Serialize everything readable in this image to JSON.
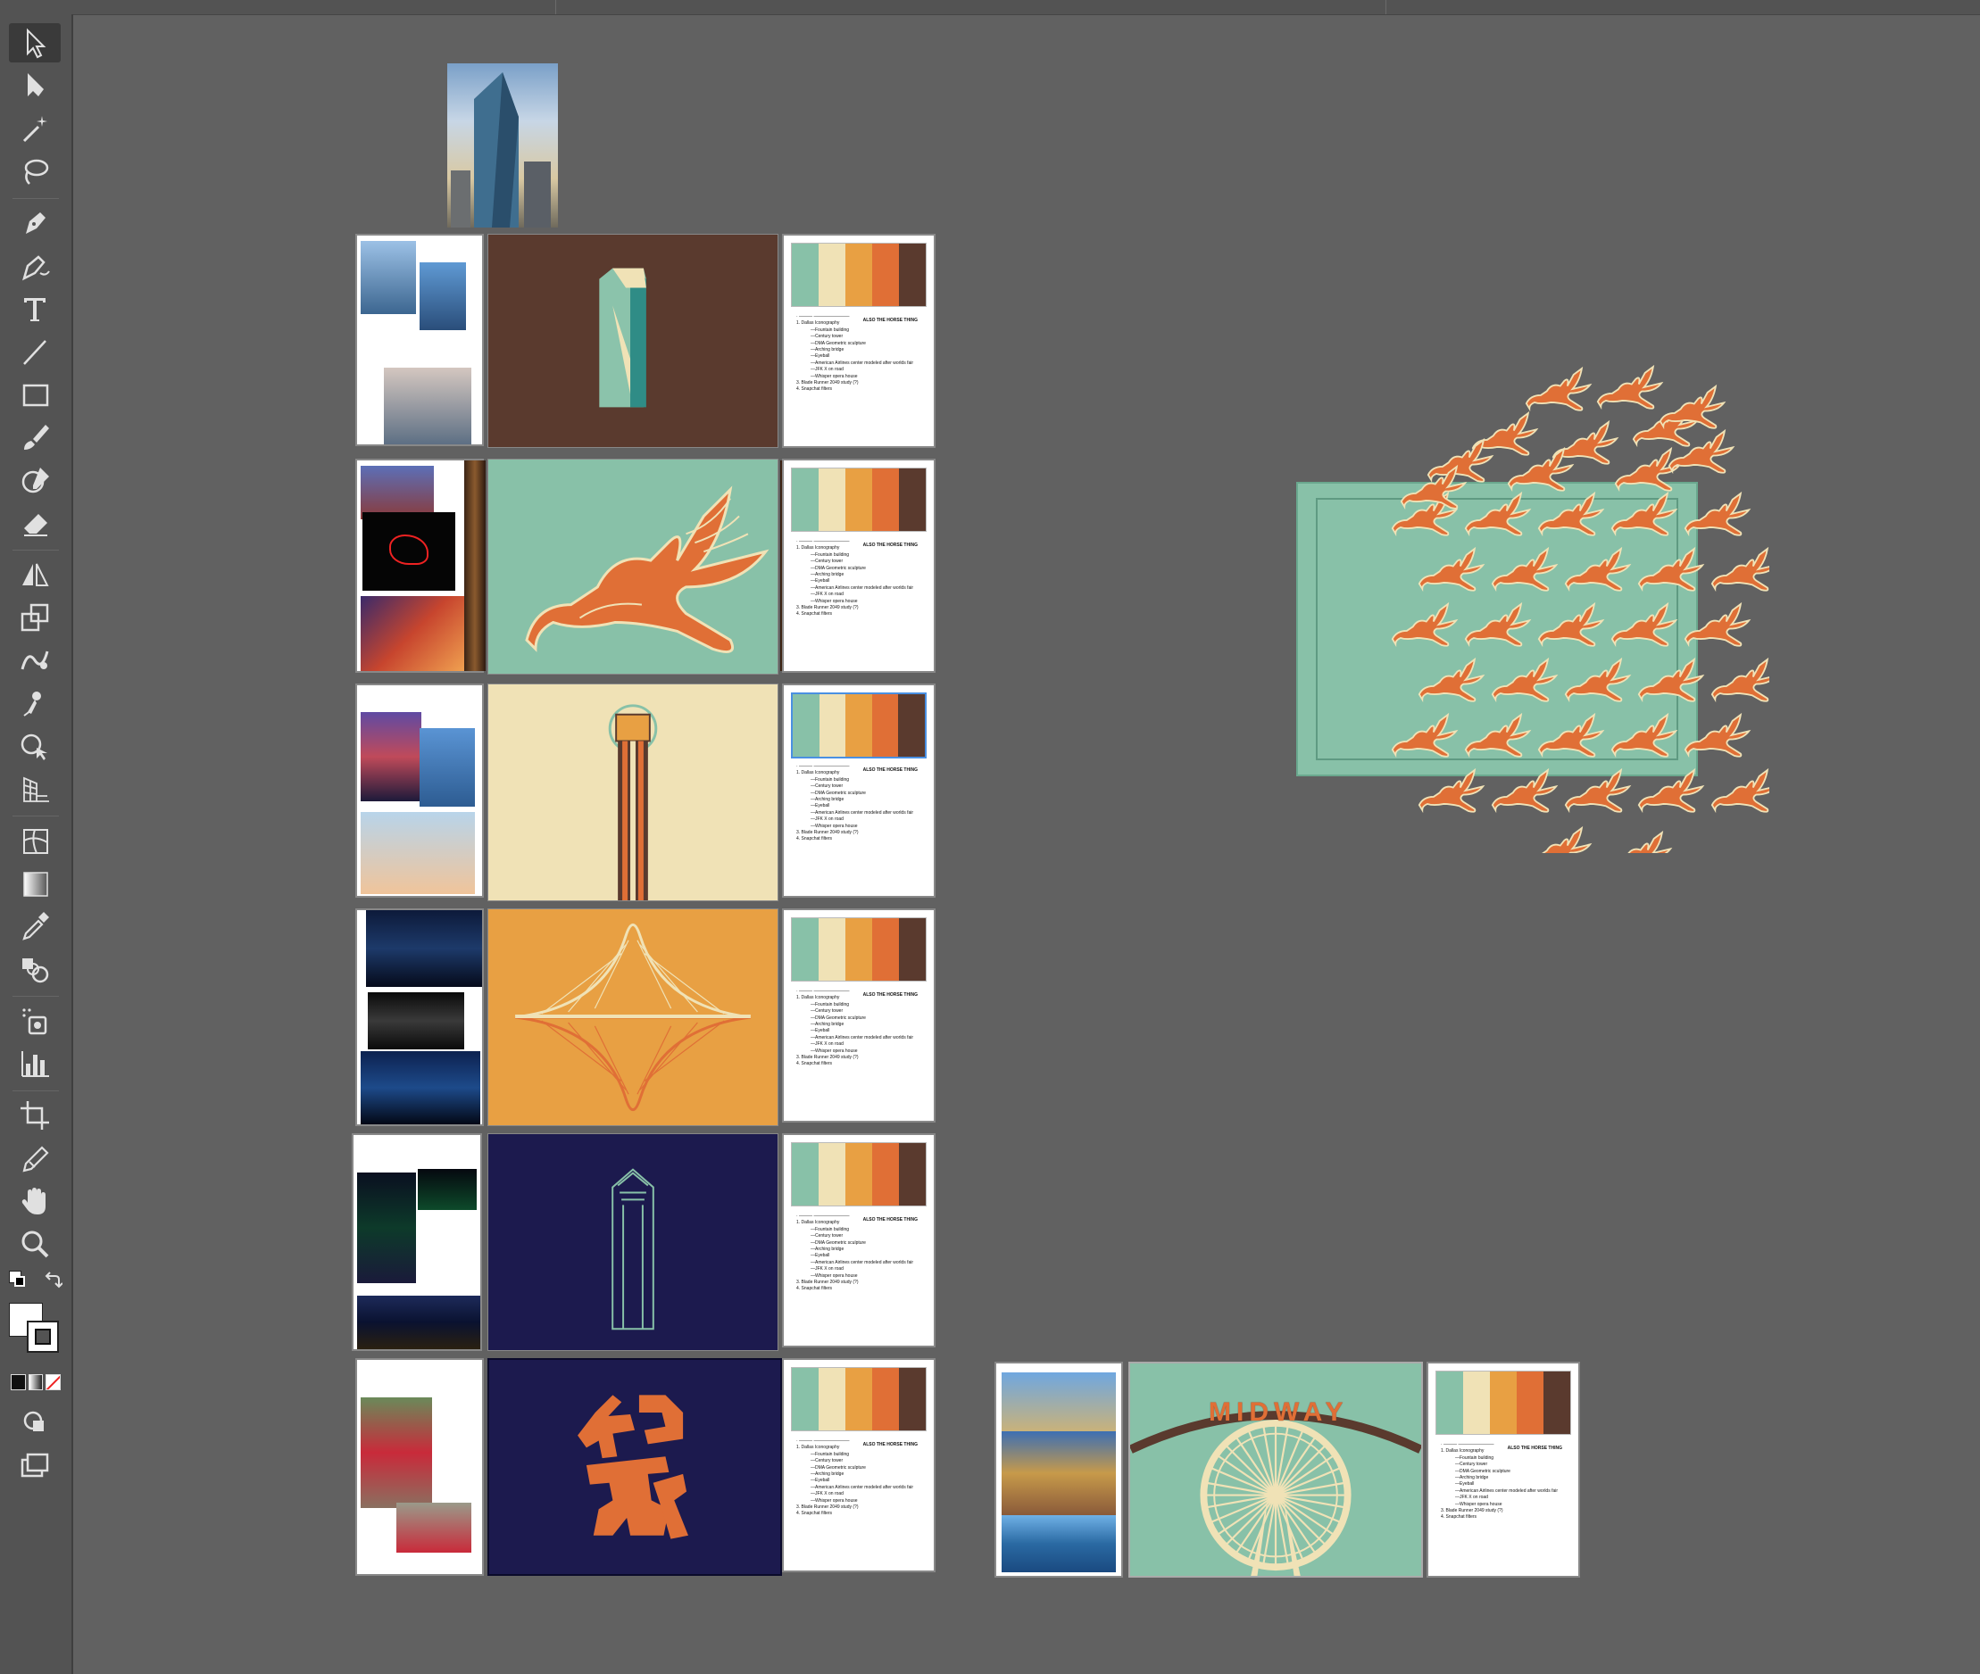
{
  "tools": [
    {
      "name": "selection-tool",
      "label": "Selection Tool"
    },
    {
      "name": "direct-selection-tool",
      "label": "Direct Selection Tool"
    },
    {
      "name": "magic-wand-tool",
      "label": "Magic Wand Tool"
    },
    {
      "name": "lasso-tool",
      "label": "Lasso Tool"
    },
    {
      "name": "pen-tool",
      "label": "Pen Tool"
    },
    {
      "name": "curvature-tool",
      "label": "Curvature Tool"
    },
    {
      "name": "type-tool",
      "label": "Type Tool"
    },
    {
      "name": "line-tool",
      "label": "Line Segment Tool"
    },
    {
      "name": "rectangle-tool",
      "label": "Rectangle Tool"
    },
    {
      "name": "paintbrush-tool",
      "label": "Paintbrush Tool"
    },
    {
      "name": "shaper-tool",
      "label": "Shaper Tool"
    },
    {
      "name": "eraser-tool",
      "label": "Eraser Tool"
    },
    {
      "name": "reflect-tool",
      "label": "Reflect Tool"
    },
    {
      "name": "scale-tool",
      "label": "Scale Tool"
    },
    {
      "name": "warp-tool",
      "label": "Warp Tool"
    },
    {
      "name": "puppet-warp-tool",
      "label": "Puppet Warp Tool"
    },
    {
      "name": "shape-builder-tool",
      "label": "Shape Builder Tool"
    },
    {
      "name": "perspective-grid-tool",
      "label": "Perspective Grid Tool"
    },
    {
      "name": "mesh-tool",
      "label": "Mesh Tool"
    },
    {
      "name": "gradient-tool",
      "label": "Gradient Tool"
    },
    {
      "name": "eyedropper-tool",
      "label": "Eyedropper Tool"
    },
    {
      "name": "blend-tool",
      "label": "Blend Tool"
    },
    {
      "name": "symbol-sprayer-tool",
      "label": "Symbol Sprayer Tool"
    },
    {
      "name": "column-graph-tool",
      "label": "Column Graph Tool"
    },
    {
      "name": "artboard-tool",
      "label": "Artboard Tool"
    },
    {
      "name": "slice-tool",
      "label": "Slice Tool"
    },
    {
      "name": "hand-tool",
      "label": "Hand Tool"
    },
    {
      "name": "zoom-tool",
      "label": "Zoom Tool"
    }
  ],
  "palette": {
    "mint": "#88c1a8",
    "cream": "#f0e2b6",
    "orange": "#e8a043",
    "burnt": "#e06f36",
    "brown": "#5a3a2e",
    "navy": "#1c1a4e",
    "bg": "#616161"
  },
  "notes": {
    "header": "ALSO THE HORSE THING",
    "line0": "·   ——— ————————",
    "item1": "1.  Dallas Iconography",
    "subs": [
      "—Fountain building",
      "—Century tower",
      "—DMA Geometric sculpture",
      "—Arching bridge",
      "—Eyeball",
      "—American Airlines center modeled after worlds fair",
      "—JFK X on road",
      "—Whisper opera house"
    ],
    "item3": "3.  Blade Runner 2049 study (?)",
    "item4": "4.  Snapchat filters"
  },
  "midway": {
    "text": "MIDWAY"
  },
  "colors": {
    "accent": "#4a90e2"
  }
}
